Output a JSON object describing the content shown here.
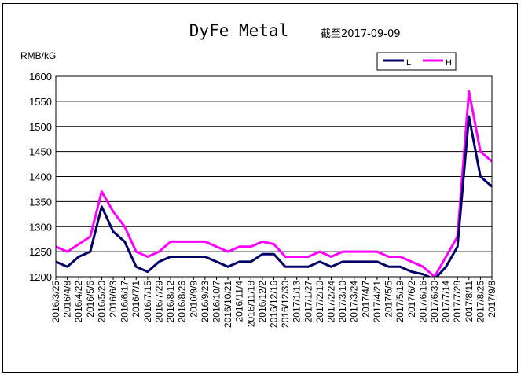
{
  "chart_data": {
    "type": "line",
    "title": "DyFe Metal",
    "subtitle": "截至2017-09-09",
    "ylabel": "RMB/kG",
    "xlabel": "",
    "ylim": [
      1200,
      1600
    ],
    "yticks": [
      1200,
      1250,
      1300,
      1350,
      1400,
      1450,
      1500,
      1550,
      1600
    ],
    "grid": true,
    "legend_position": "top-right",
    "colors": {
      "L": "#000066",
      "H": "#ff00ff"
    },
    "x_tick_labels": [
      "2016/3/25",
      "2016/4/8",
      "2016/4/22",
      "2016/5/6",
      "2016/5/20",
      "2016/6/3",
      "2016/6/17",
      "2016/7/1",
      "2016/7/15",
      "2016/7/29",
      "2016/8/12",
      "2016/8/26",
      "2016/9/9",
      "2016/9/23",
      "2016/10/7",
      "2016/10/21",
      "2016/11/4",
      "2016/11/18",
      "2016/12/2",
      "2016/12/16",
      "2016/12/30",
      "2017/1/13",
      "2017/1/27",
      "2017/2/10",
      "2017/2/24",
      "2017/3/10",
      "2017/3/24",
      "2017/4/7",
      "2017/4/21",
      "2017/5/5",
      "2017/5/19",
      "2017/6/2",
      "2017/6/16",
      "2017/6/30",
      "2017/7/14",
      "2017/7/28",
      "2017/8/11",
      "2017/8/25",
      "2017/9/8"
    ],
    "x": [
      "2016/3/25",
      "2016/4/8",
      "2016/4/22",
      "2016/5/6",
      "2016/5/20",
      "2016/6/3",
      "2016/6/17",
      "2016/7/1",
      "2016/7/15",
      "2016/7/29",
      "2016/8/12",
      "2016/8/26",
      "2016/9/9",
      "2016/9/23",
      "2016/10/7",
      "2016/10/21",
      "2016/11/4",
      "2016/11/18",
      "2016/12/2",
      "2016/12/16",
      "2016/12/30",
      "2017/1/13",
      "2017/1/27",
      "2017/2/10",
      "2017/2/24",
      "2017/3/10",
      "2017/3/24",
      "2017/4/7",
      "2017/4/21",
      "2017/5/5",
      "2017/5/19",
      "2017/6/2",
      "2017/6/16",
      "2017/6/30",
      "2017/7/14",
      "2017/7/28",
      "2017/8/11",
      "2017/8/25",
      "2017/9/8"
    ],
    "series": [
      {
        "name": "L",
        "values": [
          1230,
          1220,
          1240,
          1250,
          1340,
          1290,
          1270,
          1220,
          1210,
          1230,
          1240,
          1240,
          1240,
          1240,
          1230,
          1220,
          1230,
          1230,
          1245,
          1245,
          1220,
          1220,
          1220,
          1230,
          1220,
          1230,
          1230,
          1230,
          1230,
          1220,
          1220,
          1210,
          1205,
          1195,
          1220,
          1260,
          1520,
          1400,
          1380
        ]
      },
      {
        "name": "H",
        "values": [
          1260,
          1250,
          1265,
          1280,
          1370,
          1330,
          1300,
          1250,
          1240,
          1250,
          1270,
          1270,
          1270,
          1270,
          1260,
          1250,
          1260,
          1260,
          1270,
          1265,
          1240,
          1240,
          1240,
          1250,
          1240,
          1250,
          1250,
          1250,
          1250,
          1240,
          1240,
          1230,
          1220,
          1200,
          1240,
          1280,
          1570,
          1450,
          1430
        ]
      }
    ]
  }
}
